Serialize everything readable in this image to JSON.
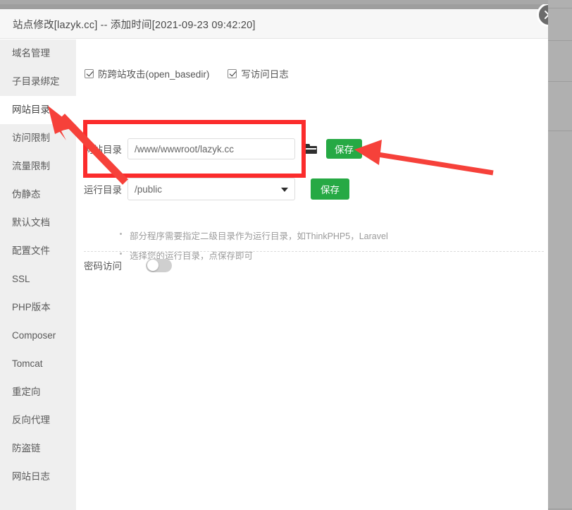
{
  "window": {
    "title": "站点修改[lazyk.cc] -- 添加时间[2021-09-23 09:42:20]",
    "close_label": "×"
  },
  "sidebar": {
    "items": [
      {
        "label": "域名管理",
        "active": false
      },
      {
        "label": "子目录绑定",
        "active": false
      },
      {
        "label": "网站目录",
        "active": true
      },
      {
        "label": "访问限制",
        "active": false
      },
      {
        "label": "流量限制",
        "active": false
      },
      {
        "label": "伪静态",
        "active": false
      },
      {
        "label": "默认文档",
        "active": false
      },
      {
        "label": "配置文件",
        "active": false
      },
      {
        "label": "SSL",
        "active": false
      },
      {
        "label": "PHP版本",
        "active": false
      },
      {
        "label": "Composer",
        "active": false
      },
      {
        "label": "Tomcat",
        "active": false
      },
      {
        "label": "重定向",
        "active": false
      },
      {
        "label": "反向代理",
        "active": false
      },
      {
        "label": "防盗链",
        "active": false
      },
      {
        "label": "网站日志",
        "active": false
      }
    ]
  },
  "content": {
    "checkboxes": [
      {
        "label": "防跨站攻击(open_basedir)",
        "checked": true
      },
      {
        "label": "写访问日志",
        "checked": true
      }
    ],
    "site_dir": {
      "label": "网站目录",
      "value": "/www/wwwroot/lazyk.cc",
      "placeholder": "",
      "browse_icon": "folder-icon",
      "save_label": "保存"
    },
    "run_dir": {
      "label": "运行目录",
      "value": "/public",
      "options": [
        "/",
        "/public"
      ],
      "caret_icon": "chevron-down-icon",
      "save_label": "保存"
    },
    "hints": [
      "部分程序需要指定二级目录作为运行目录，如ThinkPHP5，Laravel",
      "选择您的运行目录，点保存即可"
    ],
    "password_access": {
      "label": "密码访问",
      "enabled": false
    }
  },
  "colors": {
    "accent_green": "#26a944",
    "annotation_red": "#fb2c2c",
    "sidebar_bg": "#efefef",
    "titlebar_bg": "#f7f7f7",
    "backdrop": "#a8a8a8"
  }
}
